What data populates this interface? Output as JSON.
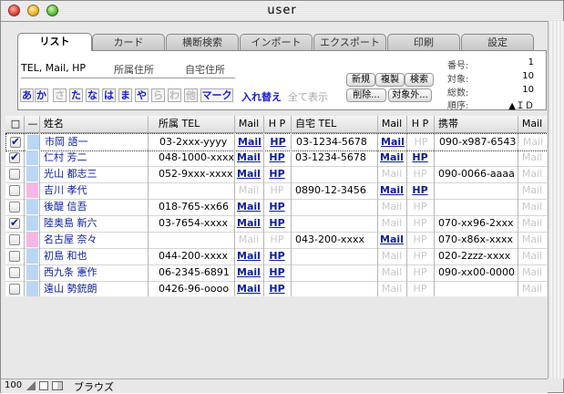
{
  "window": {
    "title": "user"
  },
  "tabs": [
    "リスト",
    "カード",
    "横断検索",
    "インポート",
    "エクスポート",
    "印刷",
    "設定"
  ],
  "filter_labels": [
    "TEL, Mail, HP",
    "所属住所",
    "自宅住所"
  ],
  "kana": [
    "あ",
    "か",
    "さ",
    "た",
    "な",
    "は",
    "ま",
    "や",
    "ら",
    "わ",
    "他"
  ],
  "kana_mark": "マーク",
  "swap_link": "入れ替え",
  "show_all_link": "全て表示",
  "buttons": {
    "new": "新規",
    "duplicate": "複製",
    "search": "検索",
    "delete": "削除...",
    "out_of_scope": "対象外..."
  },
  "info": {
    "number_label": "番号:",
    "number": "1",
    "target_label": "対象:",
    "target": "10",
    "total_label": "総数:",
    "total": "10",
    "order_label": "順序:",
    "order": "▲ＩＤ"
  },
  "columns": [
    "□",
    "—",
    "姓名",
    "所属 TEL",
    "Mail",
    "H P",
    "自宅 TEL",
    "Mail",
    "H P",
    "携帯",
    "Mail"
  ],
  "rows": [
    {
      "checked": true,
      "band": "#b9d6f5",
      "name": "市岡 語一",
      "office_tel": "03-2xxx-yyyy",
      "m1": "Mail",
      "h1": "HP",
      "home_tel": "03-1234-5678",
      "m2": "Mail",
      "h2": "HP",
      "mobile": "090-x987-6543",
      "m3": "Mail",
      "m1_on": true,
      "h1_on": true,
      "m2_on": true,
      "h2_on": false,
      "m3_on": false
    },
    {
      "checked": true,
      "band": "#b9d6f5",
      "name": "仁村 芳二",
      "office_tel": "048-1000-xxxx",
      "m1": "Mail",
      "h1": "HP",
      "home_tel": "03-1234-5678",
      "m2": "Mail",
      "h2": "HP",
      "mobile": "",
      "m3": "Mail",
      "m1_on": true,
      "h1_on": true,
      "m2_on": true,
      "h2_on": true,
      "m3_on": false
    },
    {
      "checked": false,
      "band": "#b9d6f5",
      "name": "光山 都志三",
      "office_tel": "052-9xxx-xxxx",
      "m1": "Mail",
      "h1": "HP",
      "home_tel": "",
      "m2": "Mail",
      "h2": "HP",
      "mobile": "090-0066-aaaa",
      "m3": "Mail",
      "m1_on": true,
      "h1_on": true,
      "m2_on": false,
      "h2_on": false,
      "m3_on": false
    },
    {
      "checked": false,
      "band": "#f7b6e6",
      "name": "吉川 孝代",
      "office_tel": "",
      "m1": "Mail",
      "h1": "HP",
      "home_tel": "0890-12-3456",
      "m2": "Mail",
      "h2": "HP",
      "mobile": "",
      "m3": "Mail",
      "m1_on": false,
      "h1_on": false,
      "m2_on": true,
      "h2_on": true,
      "m3_on": false
    },
    {
      "checked": false,
      "band": "#b9d6f5",
      "name": "後醍 信吾",
      "office_tel": "018-765-xx66",
      "m1": "Mail",
      "h1": "HP",
      "home_tel": "",
      "m2": "Mail",
      "h2": "HP",
      "mobile": "",
      "m3": "Mail",
      "m1_on": true,
      "h1_on": true,
      "m2_on": false,
      "h2_on": false,
      "m3_on": false
    },
    {
      "checked": true,
      "band": "#b9d6f5",
      "name": "陸奥島 新六",
      "office_tel": "03-7654-xxxx",
      "m1": "Mail",
      "h1": "HP",
      "home_tel": "",
      "m2": "Mail",
      "h2": "HP",
      "mobile": "070-xx96-2xxx",
      "m3": "Mail",
      "m1_on": true,
      "h1_on": true,
      "m2_on": false,
      "h2_on": false,
      "m3_on": false
    },
    {
      "checked": false,
      "band": "#f7b6e6",
      "name": "名古屋 奈々",
      "office_tel": "",
      "m1": "Mail",
      "h1": "HP",
      "home_tel": "043-200-xxxx",
      "m2": "Mail",
      "h2": "HP",
      "mobile": "070-x86x-xxxx",
      "m3": "Mail",
      "m1_on": false,
      "h1_on": false,
      "m2_on": true,
      "h2_on": false,
      "m3_on": false
    },
    {
      "checked": false,
      "band": "#b9d6f5",
      "name": "初島 和也",
      "office_tel": "044-200-xxxx",
      "m1": "Mail",
      "h1": "HP",
      "home_tel": "",
      "m2": "Mail",
      "h2": "HP",
      "mobile": "020-2zzz-xxxx",
      "m3": "Mail",
      "m1_on": true,
      "h1_on": true,
      "m2_on": false,
      "h2_on": false,
      "m3_on": false
    },
    {
      "checked": false,
      "band": "#b9d6f5",
      "name": "西九条 憲作",
      "office_tel": "06-2345-6891",
      "m1": "Mail",
      "h1": "HP",
      "home_tel": "",
      "m2": "Mail",
      "h2": "HP",
      "mobile": "090-xx00-0000",
      "m3": "Mail",
      "m1_on": true,
      "h1_on": true,
      "m2_on": false,
      "h2_on": false,
      "m3_on": false
    },
    {
      "checked": false,
      "band": "#b9d6f5",
      "name": "遠山 勢銃朗",
      "office_tel": "0426-96-oooo",
      "m1": "Mail",
      "h1": "HP",
      "home_tel": "",
      "m2": "Mail",
      "h2": "HP",
      "mobile": "",
      "m3": "Mail",
      "m1_on": true,
      "h1_on": true,
      "m2_on": false,
      "h2_on": false,
      "m3_on": false
    }
  ],
  "status": {
    "zoom": "100",
    "mode": "ブラウズ"
  }
}
